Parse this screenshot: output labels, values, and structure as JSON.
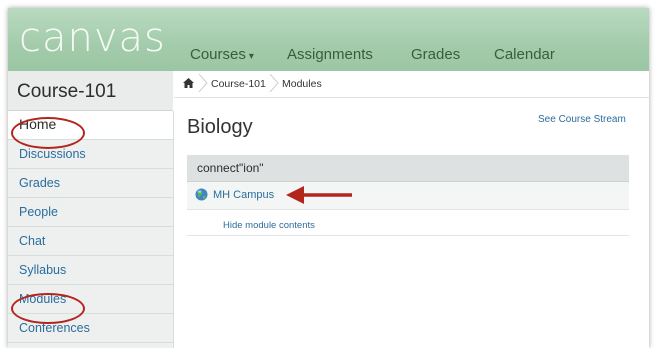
{
  "app": {
    "logo_text": "canvas"
  },
  "top_nav": {
    "items": [
      {
        "label": "Courses",
        "caret": "▾"
      },
      {
        "label": "Assignments"
      },
      {
        "label": "Grades"
      },
      {
        "label": "Calendar"
      }
    ]
  },
  "course": {
    "title": "Course-101"
  },
  "left_nav": {
    "items": [
      {
        "label": "Home"
      },
      {
        "label": "Discussions"
      },
      {
        "label": "Grades"
      },
      {
        "label": "People"
      },
      {
        "label": "Chat"
      },
      {
        "label": "Syllabus"
      },
      {
        "label": "Modules"
      },
      {
        "label": "Conferences"
      }
    ]
  },
  "breadcrumb": {
    "home_icon": "home-icon",
    "items": [
      "Course-101",
      "Modules"
    ]
  },
  "main": {
    "title": "Biology",
    "course_stream_link": "See Course Stream",
    "module": {
      "name": "connect\"ion\"",
      "item": {
        "label": "MH Campus",
        "icon": "globe-icon"
      },
      "hide_link": "Hide module contents"
    }
  },
  "annotations": {
    "color": "#b3261e"
  },
  "colors": {
    "header": "#a3cbab",
    "link": "#2a6d9e",
    "nav_text": "#375e3c"
  }
}
